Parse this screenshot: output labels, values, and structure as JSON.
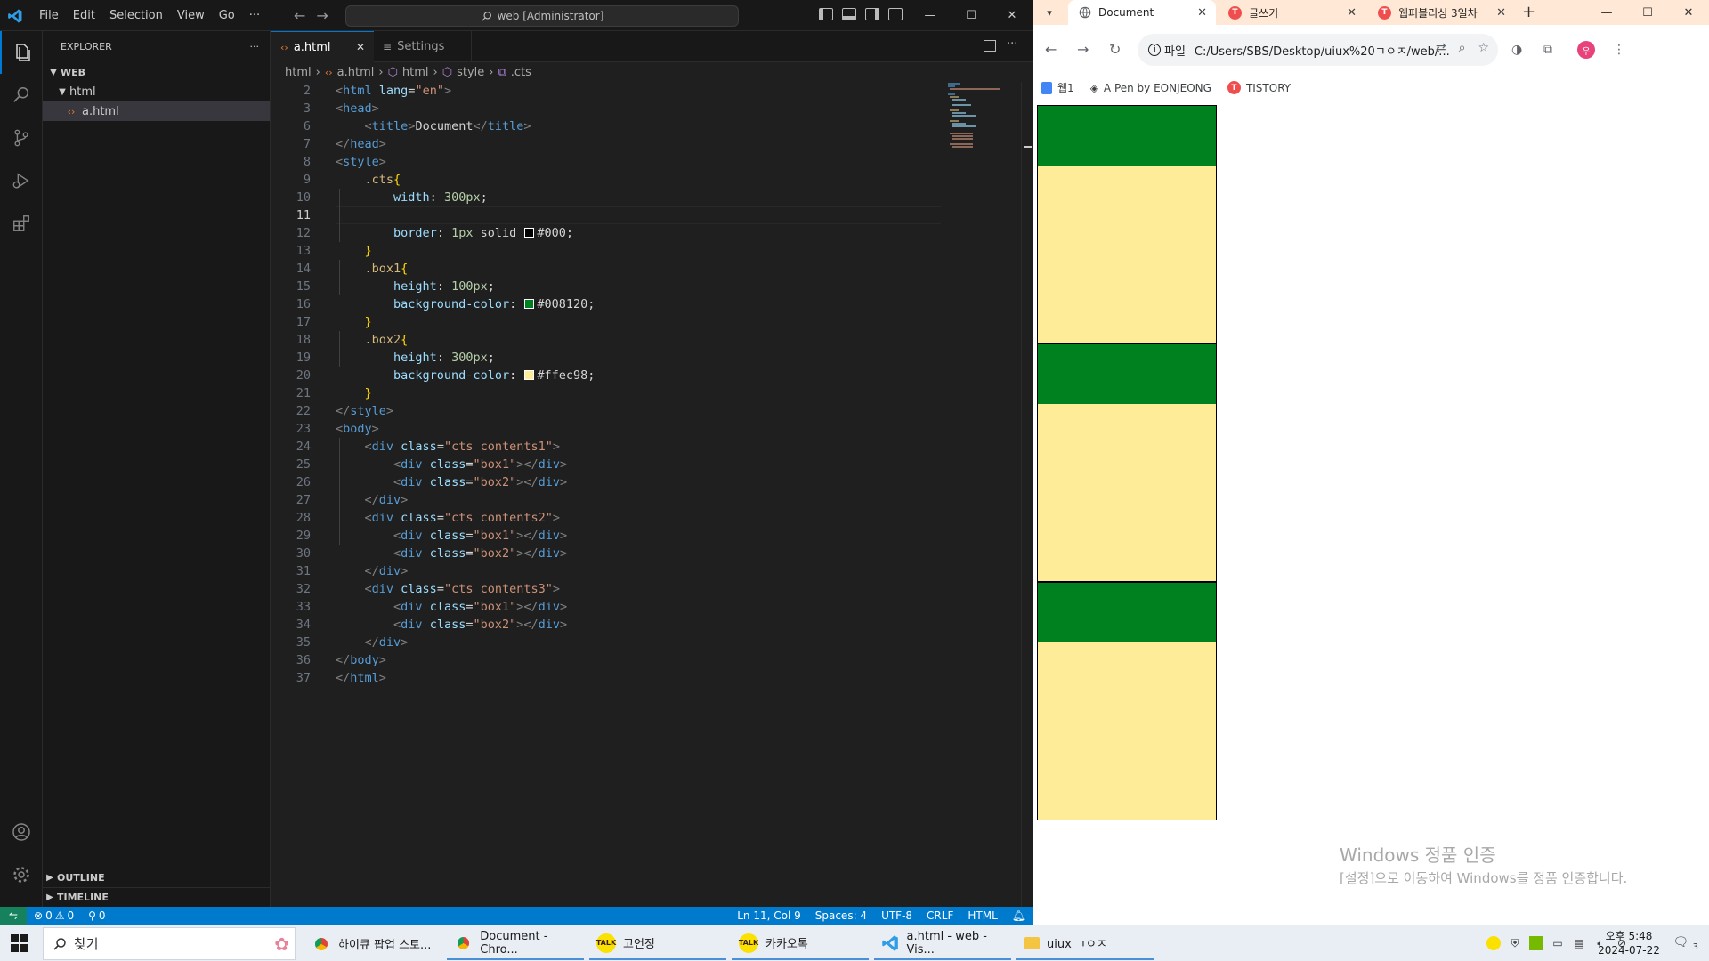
{
  "vscode": {
    "menu": [
      "File",
      "Edit",
      "Selection",
      "View",
      "Go",
      "···"
    ],
    "command_center": "web [Administrator]",
    "explorer": {
      "header": "EXPLORER",
      "more": "···",
      "root": "WEB",
      "folder": "html",
      "file": "a.html",
      "outline": "OUTLINE",
      "timeline": "TIMELINE"
    },
    "tabs": [
      {
        "label": "a.html",
        "close": "✕"
      },
      {
        "label": "Settings"
      }
    ],
    "breadcrumb": [
      "html",
      "a.html",
      "html",
      "style",
      ".cts"
    ],
    "status": {
      "errors": "0",
      "warnings": "0",
      "ports": "0",
      "position": "Ln 11, Col 9",
      "spaces": "Spaces: 4",
      "encoding": "UTF-8",
      "eol": "CRLF",
      "language": "HTML"
    },
    "code_lines": [
      {
        "n": "2",
        "segs": [
          [
            "br",
            "<"
          ],
          [
            "tag",
            "html "
          ],
          [
            "attr",
            "lang"
          ],
          [
            "txt",
            "="
          ],
          [
            "str",
            "\"en\""
          ],
          [
            "br",
            ">"
          ]
        ]
      },
      {
        "n": "3",
        "segs": [
          [
            "br",
            "<"
          ],
          [
            "tag",
            "head"
          ],
          [
            "br",
            ">"
          ]
        ]
      },
      {
        "n": "6",
        "segs": [
          [
            "txt",
            "    "
          ],
          [
            "br",
            "<"
          ],
          [
            "tag",
            "title"
          ],
          [
            "br",
            ">"
          ],
          [
            "txt",
            "Document"
          ],
          [
            "br",
            "</"
          ],
          [
            "tag",
            "title"
          ],
          [
            "br",
            ">"
          ]
        ]
      },
      {
        "n": "7",
        "segs": [
          [
            "br",
            "</"
          ],
          [
            "tag",
            "head"
          ],
          [
            "br",
            ">"
          ]
        ]
      },
      {
        "n": "8",
        "segs": [
          [
            "br",
            "<"
          ],
          [
            "tag",
            "style"
          ],
          [
            "br",
            ">"
          ]
        ]
      },
      {
        "n": "9",
        "segs": [
          [
            "txt",
            "    "
          ],
          [
            "sel",
            ".cts"
          ],
          [
            "brace",
            "{"
          ]
        ]
      },
      {
        "n": "10",
        "segs": [
          [
            "txt",
            "        "
          ],
          [
            "prop",
            "width"
          ],
          [
            "txt",
            ": "
          ],
          [
            "num",
            "300px"
          ],
          [
            "txt",
            ";"
          ]
        ]
      },
      {
        "n": "11",
        "segs": []
      },
      {
        "n": "12",
        "segs": [
          [
            "txt",
            "        "
          ],
          [
            "prop",
            "border"
          ],
          [
            "txt",
            ": "
          ],
          [
            "num",
            "1px"
          ],
          [
            "txt",
            " solid "
          ],
          [
            "swatch",
            "#000000"
          ],
          [
            "txt",
            "#000;"
          ]
        ]
      },
      {
        "n": "13",
        "segs": [
          [
            "txt",
            "    "
          ],
          [
            "brace",
            "}"
          ]
        ]
      },
      {
        "n": "14",
        "segs": [
          [
            "txt",
            "    "
          ],
          [
            "sel",
            ".box1"
          ],
          [
            "brace",
            "{"
          ]
        ]
      },
      {
        "n": "15",
        "segs": [
          [
            "txt",
            "        "
          ],
          [
            "prop",
            "height"
          ],
          [
            "txt",
            ": "
          ],
          [
            "num",
            "100px"
          ],
          [
            "txt",
            ";"
          ]
        ]
      },
      {
        "n": "16",
        "segs": [
          [
            "txt",
            "        "
          ],
          [
            "prop",
            "background-color"
          ],
          [
            "txt",
            ": "
          ],
          [
            "swatch",
            "#008120"
          ],
          [
            "txt",
            "#008120;"
          ]
        ]
      },
      {
        "n": "17",
        "segs": [
          [
            "txt",
            "    "
          ],
          [
            "brace",
            "}"
          ]
        ]
      },
      {
        "n": "18",
        "segs": [
          [
            "txt",
            "    "
          ],
          [
            "sel",
            ".box2"
          ],
          [
            "brace",
            "{"
          ]
        ]
      },
      {
        "n": "19",
        "segs": [
          [
            "txt",
            "        "
          ],
          [
            "prop",
            "height"
          ],
          [
            "txt",
            ": "
          ],
          [
            "num",
            "300px"
          ],
          [
            "txt",
            ";"
          ]
        ]
      },
      {
        "n": "20",
        "segs": [
          [
            "txt",
            "        "
          ],
          [
            "prop",
            "background-color"
          ],
          [
            "txt",
            ": "
          ],
          [
            "swatch",
            "#ffec98"
          ],
          [
            "txt",
            "#ffec98;"
          ]
        ]
      },
      {
        "n": "21",
        "segs": [
          [
            "txt",
            "    "
          ],
          [
            "brace",
            "}"
          ]
        ]
      },
      {
        "n": "22",
        "segs": [
          [
            "br",
            "</"
          ],
          [
            "tag",
            "style"
          ],
          [
            "br",
            ">"
          ]
        ]
      },
      {
        "n": "23",
        "segs": [
          [
            "br",
            "<"
          ],
          [
            "tag",
            "body"
          ],
          [
            "br",
            ">"
          ]
        ]
      },
      {
        "n": "24",
        "segs": [
          [
            "txt",
            "    "
          ],
          [
            "br",
            "<"
          ],
          [
            "tag",
            "div "
          ],
          [
            "attr",
            "class"
          ],
          [
            "txt",
            "="
          ],
          [
            "str",
            "\"cts contents1\""
          ],
          [
            "br",
            ">"
          ]
        ]
      },
      {
        "n": "25",
        "segs": [
          [
            "txt",
            "        "
          ],
          [
            "br",
            "<"
          ],
          [
            "tag",
            "div "
          ],
          [
            "attr",
            "class"
          ],
          [
            "txt",
            "="
          ],
          [
            "str",
            "\"box1\""
          ],
          [
            "br",
            "></"
          ],
          [
            "tag",
            "div"
          ],
          [
            "br",
            ">"
          ]
        ]
      },
      {
        "n": "26",
        "segs": [
          [
            "txt",
            "        "
          ],
          [
            "br",
            "<"
          ],
          [
            "tag",
            "div "
          ],
          [
            "attr",
            "class"
          ],
          [
            "txt",
            "="
          ],
          [
            "str",
            "\"box2\""
          ],
          [
            "br",
            "></"
          ],
          [
            "tag",
            "div"
          ],
          [
            "br",
            ">"
          ]
        ]
      },
      {
        "n": "27",
        "segs": [
          [
            "txt",
            "    "
          ],
          [
            "br",
            "</"
          ],
          [
            "tag",
            "div"
          ],
          [
            "br",
            ">"
          ]
        ]
      },
      {
        "n": "28",
        "segs": [
          [
            "txt",
            "    "
          ],
          [
            "br",
            "<"
          ],
          [
            "tag",
            "div "
          ],
          [
            "attr",
            "class"
          ],
          [
            "txt",
            "="
          ],
          [
            "str",
            "\"cts contents2\""
          ],
          [
            "br",
            ">"
          ]
        ]
      },
      {
        "n": "29",
        "segs": [
          [
            "txt",
            "        "
          ],
          [
            "br",
            "<"
          ],
          [
            "tag",
            "div "
          ],
          [
            "attr",
            "class"
          ],
          [
            "txt",
            "="
          ],
          [
            "str",
            "\"box1\""
          ],
          [
            "br",
            "></"
          ],
          [
            "tag",
            "div"
          ],
          [
            "br",
            ">"
          ]
        ]
      },
      {
        "n": "30",
        "segs": [
          [
            "txt",
            "        "
          ],
          [
            "br",
            "<"
          ],
          [
            "tag",
            "div "
          ],
          [
            "attr",
            "class"
          ],
          [
            "txt",
            "="
          ],
          [
            "str",
            "\"box2\""
          ],
          [
            "br",
            "></"
          ],
          [
            "tag",
            "div"
          ],
          [
            "br",
            ">"
          ]
        ]
      },
      {
        "n": "31",
        "segs": [
          [
            "txt",
            "    "
          ],
          [
            "br",
            "</"
          ],
          [
            "tag",
            "div"
          ],
          [
            "br",
            ">"
          ]
        ]
      },
      {
        "n": "32",
        "segs": [
          [
            "txt",
            "    "
          ],
          [
            "br",
            "<"
          ],
          [
            "tag",
            "div "
          ],
          [
            "attr",
            "class"
          ],
          [
            "txt",
            "="
          ],
          [
            "str",
            "\"cts contents3\""
          ],
          [
            "br",
            ">"
          ]
        ]
      },
      {
        "n": "33",
        "segs": [
          [
            "txt",
            "        "
          ],
          [
            "br",
            "<"
          ],
          [
            "tag",
            "div "
          ],
          [
            "attr",
            "class"
          ],
          [
            "txt",
            "="
          ],
          [
            "str",
            "\"box1\""
          ],
          [
            "br",
            "></"
          ],
          [
            "tag",
            "div"
          ],
          [
            "br",
            ">"
          ]
        ]
      },
      {
        "n": "34",
        "segs": [
          [
            "txt",
            "        "
          ],
          [
            "br",
            "<"
          ],
          [
            "tag",
            "div "
          ],
          [
            "attr",
            "class"
          ],
          [
            "txt",
            "="
          ],
          [
            "str",
            "\"box2\""
          ],
          [
            "br",
            "></"
          ],
          [
            "tag",
            "div"
          ],
          [
            "br",
            ">"
          ]
        ]
      },
      {
        "n": "35",
        "segs": [
          [
            "txt",
            "    "
          ],
          [
            "br",
            "</"
          ],
          [
            "tag",
            "div"
          ],
          [
            "br",
            ">"
          ]
        ]
      },
      {
        "n": "36",
        "segs": [
          [
            "br",
            "</"
          ],
          [
            "tag",
            "body"
          ],
          [
            "br",
            ">"
          ]
        ]
      },
      {
        "n": "37",
        "segs": [
          [
            "br",
            "</"
          ],
          [
            "tag",
            "html"
          ],
          [
            "br",
            ">"
          ]
        ]
      }
    ],
    "current_line": "11"
  },
  "chrome": {
    "tabs": [
      {
        "label": "Document",
        "favicon": "globe-icon"
      },
      {
        "label": "글쓰기",
        "favicon": "T"
      },
      {
        "label": "웹퍼블리싱 3일차",
        "favicon": "T"
      }
    ],
    "new_tab": "+",
    "address_chip": "파일",
    "address": "C:/Users/SBS/Desktop/uiux%20ㄱㅇㅈ/web/...",
    "bookmarks": [
      "웹1",
      "A Pen by EONJEONG",
      "TISTORY"
    ],
    "profile_initial": "우",
    "rendered": {
      "box1_color": "#008120",
      "box2_color": "#ffec98",
      "border_color": "#000000",
      "containers": [
        "contents1",
        "contents2",
        "contents3"
      ]
    },
    "activation_title": "Windows 정품 인증",
    "activation_sub": "[설정]으로 이동하여 Windows를 정품 인증합니다."
  },
  "taskbar": {
    "search": "찾기",
    "apps": [
      {
        "label": "하이큐 팝업 스토...",
        "icon": "chrome-icon"
      },
      {
        "label": "Document - Chro...",
        "icon": "chrome-icon"
      },
      {
        "label": "고언정",
        "icon": "kakaotalk-icon"
      },
      {
        "label": "카카오톡",
        "icon": "kakaotalk-icon"
      },
      {
        "label": "a.html - web - Vis...",
        "icon": "vscode-icon"
      },
      {
        "label": "uiux ㄱㅇㅈ",
        "icon": "folder-icon"
      }
    ],
    "talk_badge": "TALK",
    "clock_time": "오후 5:48",
    "clock_date": "2024-07-22",
    "notifications": "3"
  }
}
